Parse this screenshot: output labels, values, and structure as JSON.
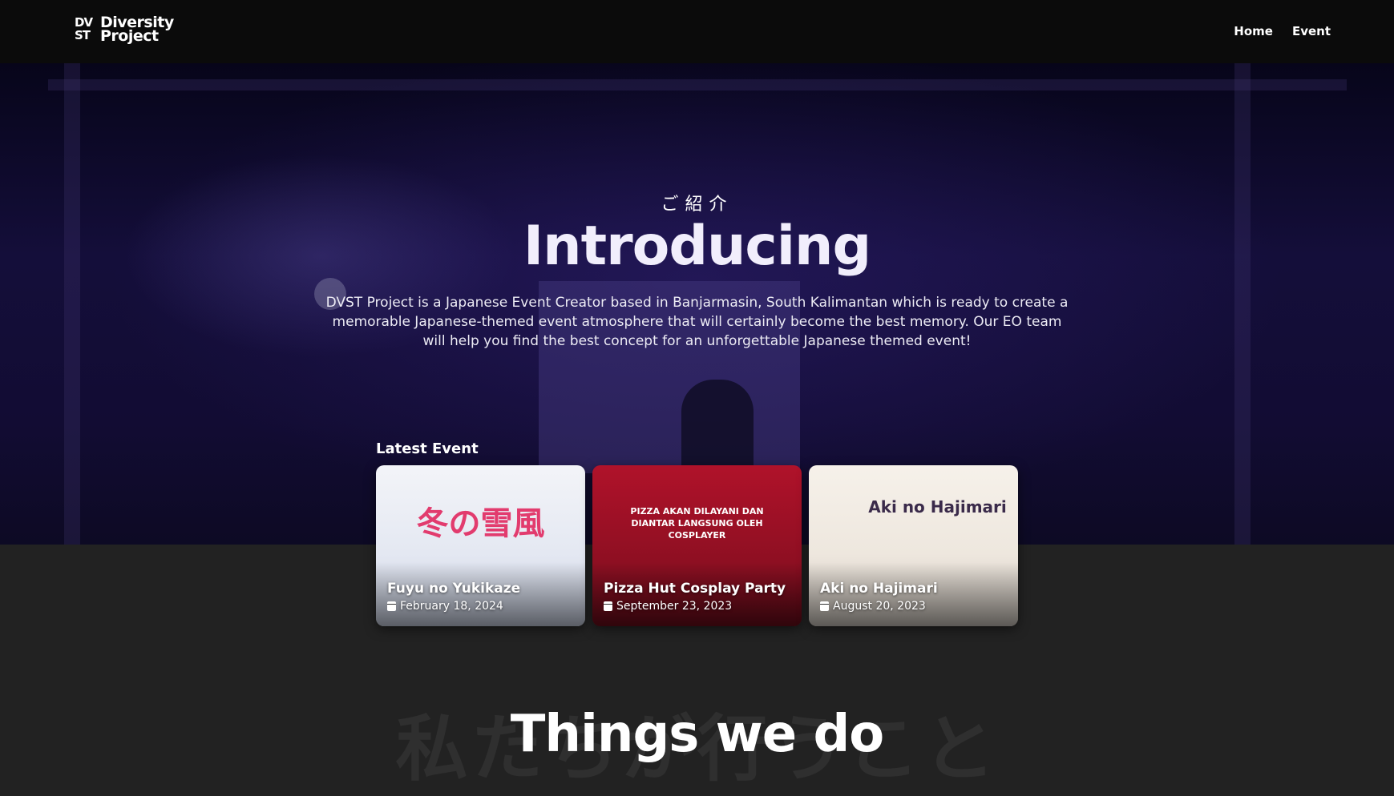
{
  "nav": {
    "logo_mark_top": "DV",
    "logo_mark_bottom": "ST",
    "logo_line1": "Diversity",
    "logo_line2": "Project",
    "links": [
      {
        "label": "Home"
      },
      {
        "label": "Event"
      }
    ]
  },
  "hero": {
    "kana": "ご紹介",
    "title": "Introducing",
    "description": "DVST Project is a Japanese Event Creator based in Banjarmasin, South Kalimantan which is ready to create a memorable Japanese-themed event atmosphere that will certainly become the best memory. Our EO team will help you find the best concept for an unforgettable Japanese themed event!"
  },
  "latest": {
    "label": "Latest Event",
    "events": [
      {
        "name": "Fuyu no Yukikaze",
        "date": "February 18, 2024",
        "poster_title": "冬の雪風",
        "accent": "#e23b6e"
      },
      {
        "name": "Pizza Hut Cosplay Party",
        "date": "September 23, 2023",
        "poster_title": "PIZZA AKAN DILAYANI DAN DIANTAR LANGSUNG OLEH COSPLAYER",
        "accent": "#b0122a"
      },
      {
        "name": "Aki no Hajimari",
        "date": "August 20, 2023",
        "poster_title": "Aki no Hajimari",
        "accent": "#b22a2a"
      }
    ]
  },
  "things": {
    "bg_text": "私たちが行うこと",
    "title": "Things we do"
  }
}
